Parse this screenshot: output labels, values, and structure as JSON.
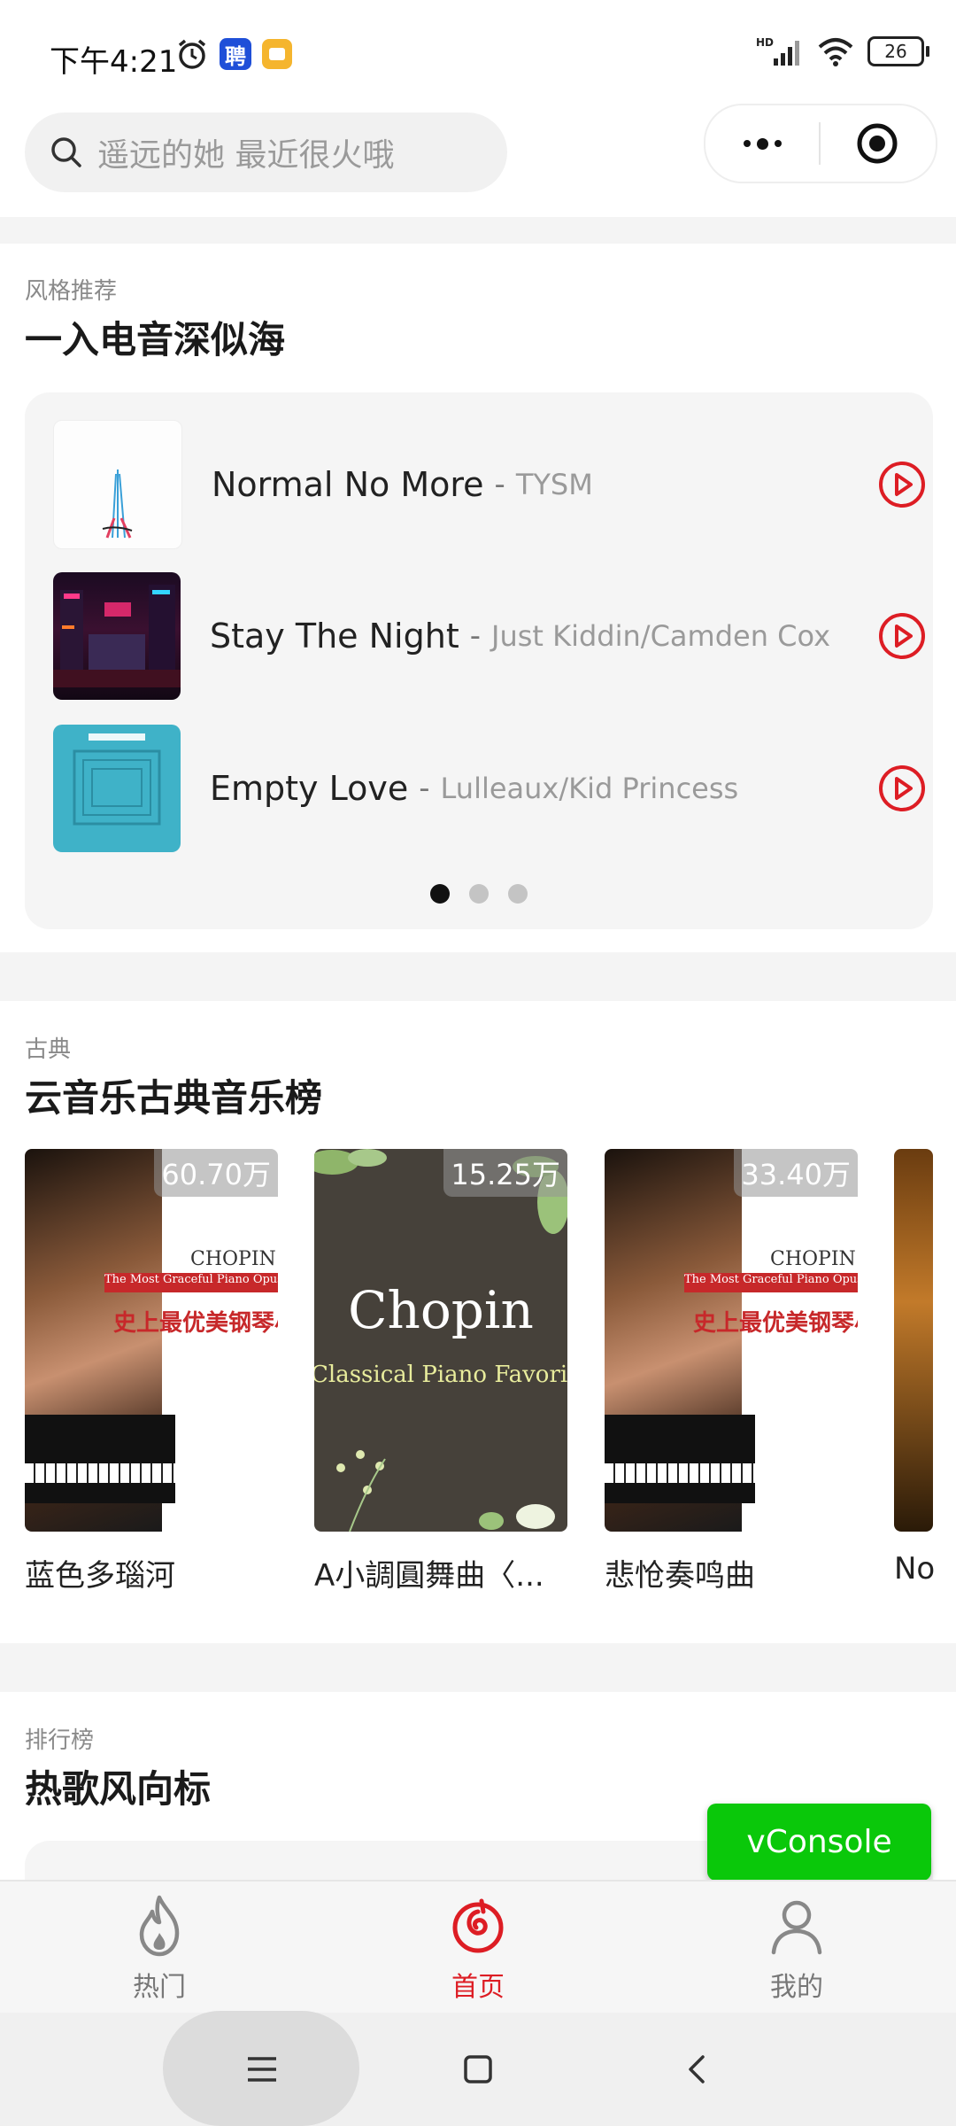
{
  "status": {
    "time": "下午4:21",
    "network": "HD",
    "battery": "26"
  },
  "search": {
    "placeholder": "遥远的她 最近很火哦"
  },
  "style_section": {
    "subtitle": "风格推荐",
    "title": "一入电音深似海",
    "songs": [
      {
        "name": "Normal No More",
        "artist": "TYSM"
      },
      {
        "name": "Stay The Night",
        "artist": "Just Kiddin/Camden Cox"
      },
      {
        "name": "Empty Love",
        "artist": "Lulleaux/Kid Princess"
      }
    ],
    "dash": "-",
    "page_count": 3,
    "active_page": 1
  },
  "classical_section": {
    "subtitle": "古典",
    "title": "云音乐古典音乐榜",
    "albums": [
      {
        "name": "蓝色多瑙河",
        "plays": "60.70万",
        "cover_text": {
          "brand": "CHOPIN",
          "banner": "The Most Graceful Piano Opuscule",
          "cn": "史上最优美钢琴小"
        }
      },
      {
        "name": "A小調圓舞曲〈...",
        "plays": "15.25万",
        "cover_text": {
          "title": "Chopin",
          "subtitle": "Classical Piano Favorites"
        }
      },
      {
        "name": "悲怆奏鸣曲",
        "plays": "33.40万",
        "cover_text": {
          "brand": "CHOPIN",
          "banner": "The Most Graceful Piano Opuscule",
          "cn": "史上最优美钢琴小"
        }
      },
      {
        "name": "No",
        "plays": ""
      }
    ]
  },
  "chart_section": {
    "subtitle": "排行榜",
    "title": "热歌风向标"
  },
  "vconsole": "vConsole",
  "tabs": [
    {
      "label": "热门",
      "icon": "flame-icon"
    },
    {
      "label": "首页",
      "icon": "netease-logo-icon",
      "active": true
    },
    {
      "label": "我的",
      "icon": "user-icon"
    }
  ],
  "colors": {
    "accent": "#dd1d24",
    "vconsole": "#0ac80a",
    "band": "#f4f4f4"
  }
}
